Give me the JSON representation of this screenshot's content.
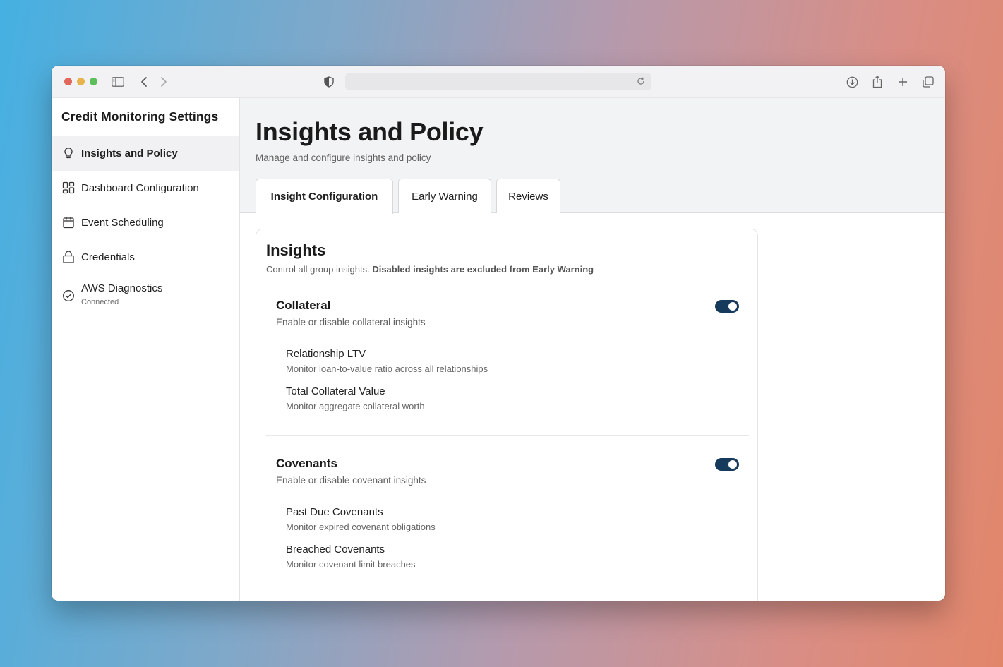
{
  "sidebar": {
    "title": "Credit Monitoring Settings",
    "items": [
      {
        "label": "Insights and Policy",
        "icon": "lightbulb-icon",
        "active": true
      },
      {
        "label": "Dashboard Configuration",
        "icon": "dashboard-grid-icon"
      },
      {
        "label": "Event Scheduling",
        "icon": "calendar-icon"
      },
      {
        "label": "Credentials",
        "icon": "lock-icon"
      },
      {
        "label": "AWS Diagnostics",
        "sub": "Connected",
        "icon": "check-circle-icon"
      }
    ]
  },
  "main": {
    "title": "Insights and Policy",
    "subtitle": "Manage and configure insights and policy",
    "tabs": [
      {
        "label": "Insight Configuration",
        "active": true
      },
      {
        "label": "Early Warning"
      },
      {
        "label": "Reviews"
      }
    ]
  },
  "card": {
    "title": "Insights",
    "desc_plain": "Control all group insights.",
    "desc_bold": "Disabled insights are excluded from Early Warning",
    "groups": [
      {
        "title": "Collateral",
        "desc": "Enable or disable collateral insights",
        "enabled": true,
        "items": [
          {
            "title": "Relationship LTV",
            "desc": "Monitor loan-to-value ratio across all relationships"
          },
          {
            "title": "Total Collateral Value",
            "desc": "Monitor aggregate collateral worth"
          }
        ]
      },
      {
        "title": "Covenants",
        "desc": "Enable or disable covenant insights",
        "enabled": true,
        "items": [
          {
            "title": "Past Due Covenants",
            "desc": "Monitor expired covenant obligations"
          },
          {
            "title": "Breached Covenants",
            "desc": "Monitor covenant limit breaches"
          }
        ]
      }
    ]
  },
  "colors": {
    "toggle_on": "#163a5c",
    "header_band": "#f2f3f5"
  }
}
